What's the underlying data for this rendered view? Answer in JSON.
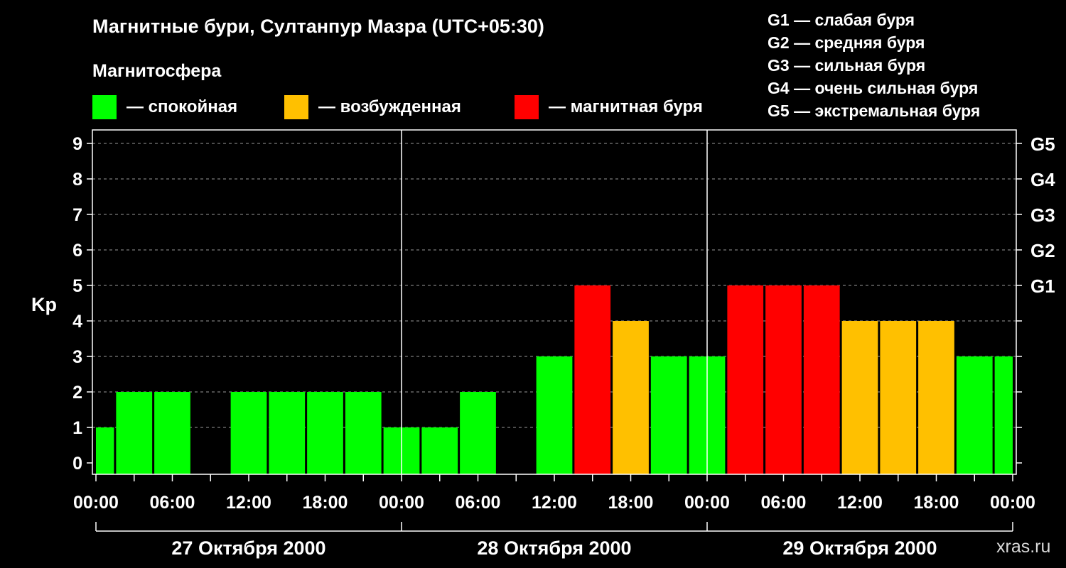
{
  "title": "Магнитные бури, Султанпур Мазра (UTC+05:30)",
  "subtitle": "Магнитосфера",
  "legend": [
    {
      "label": "— спокойная",
      "color": "#00ff00"
    },
    {
      "label": "— возбужденная",
      "color": "#ffc000"
    },
    {
      "label": "— магнитная буря",
      "color": "#ff0000"
    }
  ],
  "g_levels": [
    "G1 — слабая буря",
    "G2 — средняя буря",
    "G3 — сильная буря",
    "G4 — очень сильная буря",
    "G5 — экстремальная буря"
  ],
  "watermark": "xras.ru",
  "chart_data": {
    "type": "bar",
    "ylabel": "Kp",
    "ylim": [
      0,
      9
    ],
    "yticks": [
      "0",
      "1",
      "2",
      "3",
      "4",
      "5",
      "6",
      "7",
      "8",
      "9"
    ],
    "right_ticks": [
      {
        "kp": 5,
        "label": "G1"
      },
      {
        "kp": 6,
        "label": "G2"
      },
      {
        "kp": 7,
        "label": "G3"
      },
      {
        "kp": 8,
        "label": "G4"
      },
      {
        "kp": 9,
        "label": "G5"
      }
    ],
    "grid": "dashed horizontal",
    "xticks": [
      "00:00",
      "06:00",
      "12:00",
      "18:00",
      "00:00",
      "06:00",
      "12:00",
      "18:00",
      "00:00",
      "06:00",
      "12:00",
      "18:00",
      "00:00"
    ],
    "days": [
      "27 Октября 2000",
      "28 Октября 2000",
      "29 Октября 2000"
    ],
    "colors": {
      "quiet": "#00ff00",
      "unsettled": "#ffc000",
      "storm": "#ff0000"
    },
    "bars": [
      {
        "start_hour": 0,
        "end_hour": 1.5,
        "kp": 1,
        "level": "quiet"
      },
      {
        "start_hour": 1.5,
        "end_hour": 4.5,
        "kp": 2,
        "level": "quiet"
      },
      {
        "start_hour": 4.5,
        "end_hour": 7.5,
        "kp": 2,
        "level": "quiet"
      },
      {
        "start_hour": 7.5,
        "end_hour": 10.5,
        "kp": 0,
        "level": "quiet"
      },
      {
        "start_hour": 10.5,
        "end_hour": 13.5,
        "kp": 2,
        "level": "quiet"
      },
      {
        "start_hour": 13.5,
        "end_hour": 16.5,
        "kp": 2,
        "level": "quiet"
      },
      {
        "start_hour": 16.5,
        "end_hour": 19.5,
        "kp": 2,
        "level": "quiet"
      },
      {
        "start_hour": 19.5,
        "end_hour": 22.5,
        "kp": 2,
        "level": "quiet"
      },
      {
        "start_hour": 22.5,
        "end_hour": 25.5,
        "kp": 1,
        "level": "quiet"
      },
      {
        "start_hour": 25.5,
        "end_hour": 28.5,
        "kp": 1,
        "level": "quiet"
      },
      {
        "start_hour": 28.5,
        "end_hour": 31.5,
        "kp": 2,
        "level": "quiet"
      },
      {
        "start_hour": 31.5,
        "end_hour": 34.5,
        "kp": 0,
        "level": "quiet"
      },
      {
        "start_hour": 34.5,
        "end_hour": 37.5,
        "kp": 3,
        "level": "quiet"
      },
      {
        "start_hour": 37.5,
        "end_hour": 40.5,
        "kp": 5,
        "level": "storm"
      },
      {
        "start_hour": 40.5,
        "end_hour": 43.5,
        "kp": 4,
        "level": "unsettled"
      },
      {
        "start_hour": 43.5,
        "end_hour": 46.5,
        "kp": 3,
        "level": "quiet"
      },
      {
        "start_hour": 46.5,
        "end_hour": 49.5,
        "kp": 3,
        "level": "quiet"
      },
      {
        "start_hour": 49.5,
        "end_hour": 52.5,
        "kp": 5,
        "level": "storm"
      },
      {
        "start_hour": 52.5,
        "end_hour": 55.5,
        "kp": 5,
        "level": "storm"
      },
      {
        "start_hour": 55.5,
        "end_hour": 58.5,
        "kp": 5,
        "level": "storm"
      },
      {
        "start_hour": 58.5,
        "end_hour": 61.5,
        "kp": 4,
        "level": "unsettled"
      },
      {
        "start_hour": 61.5,
        "end_hour": 64.5,
        "kp": 4,
        "level": "unsettled"
      },
      {
        "start_hour": 64.5,
        "end_hour": 67.5,
        "kp": 4,
        "level": "unsettled"
      },
      {
        "start_hour": 67.5,
        "end_hour": 70.5,
        "kp": 3,
        "level": "quiet"
      },
      {
        "start_hour": 70.5,
        "end_hour": 72,
        "kp": 3,
        "level": "quiet"
      }
    ]
  }
}
